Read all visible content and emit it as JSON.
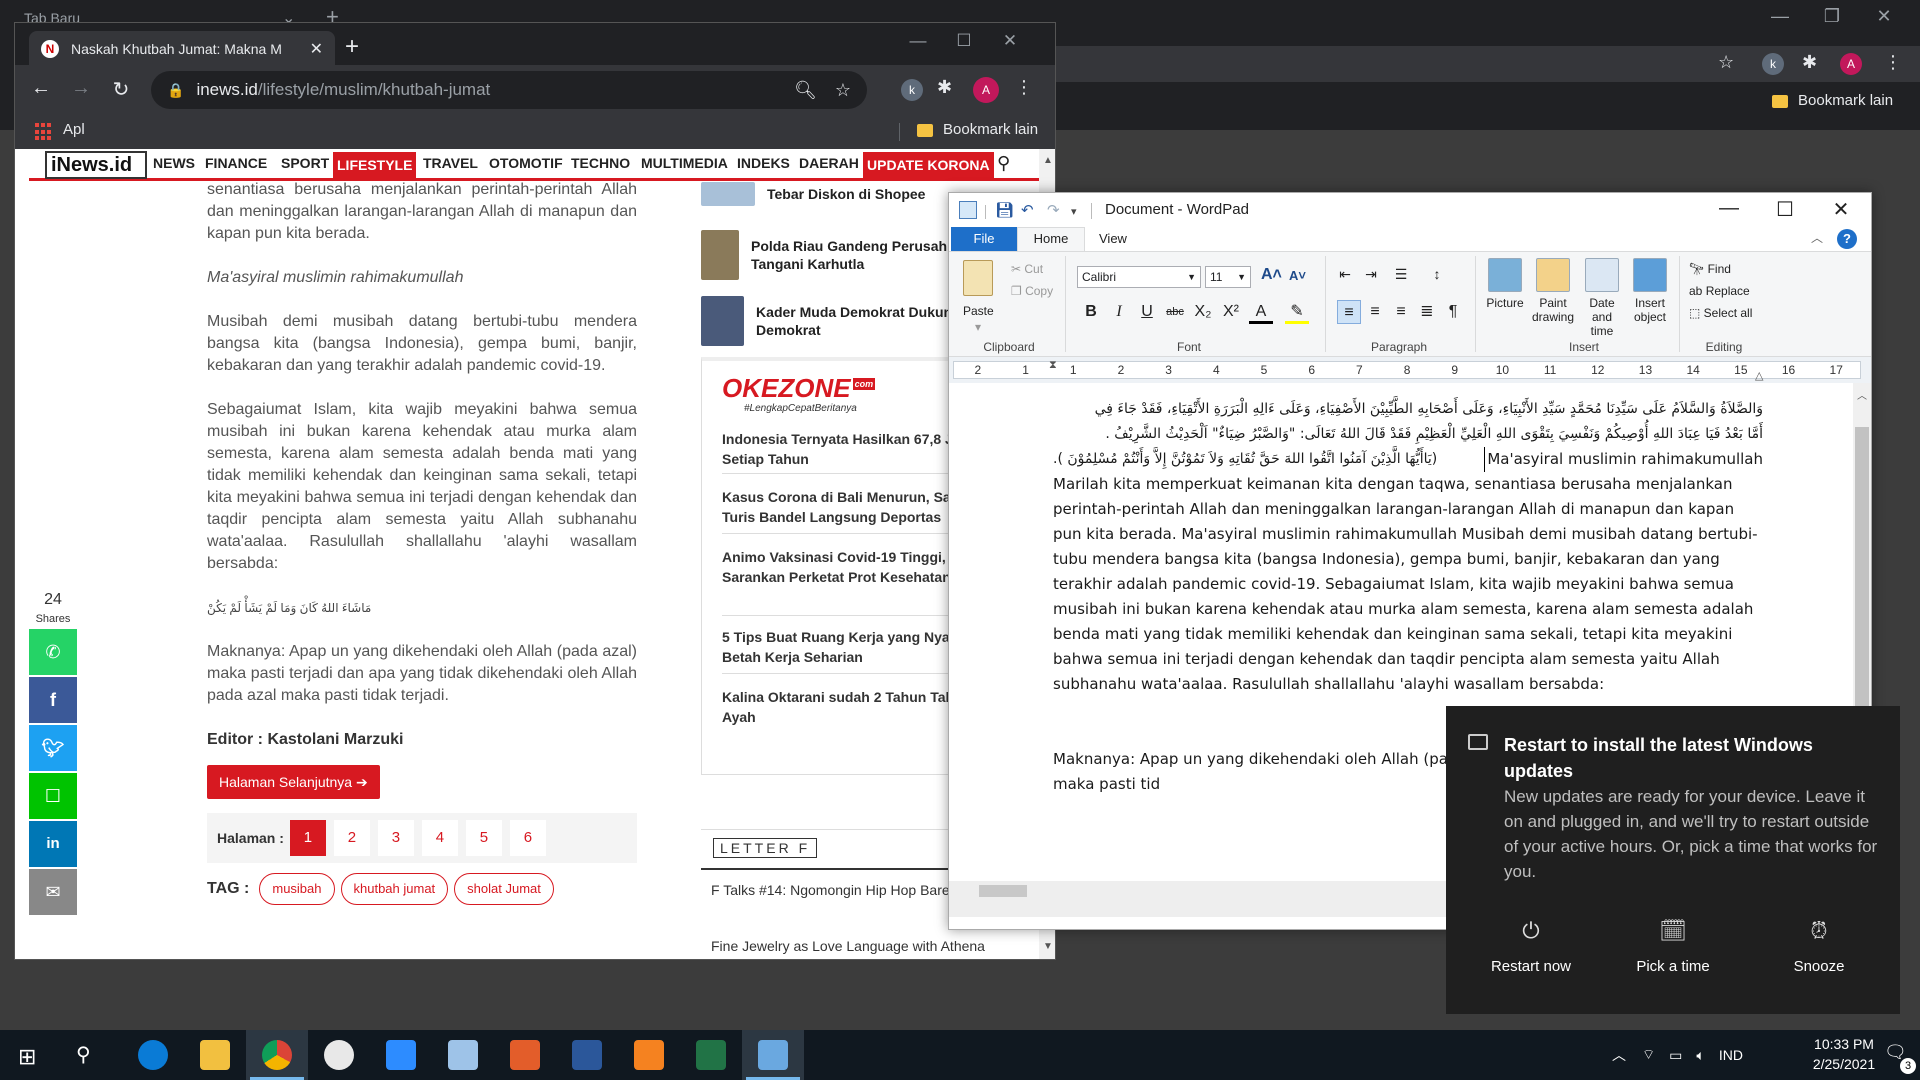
{
  "bg_chrome": {
    "tab_title": "Tab Baru",
    "bookmark_other": "Bookmark lain",
    "profile_initial": "A"
  },
  "chrome": {
    "tab_title": "Naskah Khutbah Jumat: Makna M",
    "url_host": "inews.id",
    "url_path": "/lifestyle/muslim/khutbah-jumat",
    "profile_initial": "A",
    "bookmarks": {
      "apps": "Apl",
      "other": "Bookmark lain"
    }
  },
  "site": {
    "logo": "iNews.id",
    "nav": [
      {
        "label": "NEWS",
        "highlight": false
      },
      {
        "label": "FINANCE",
        "highlight": false
      },
      {
        "label": "SPORT",
        "highlight": false
      },
      {
        "label": "LIFESTYLE",
        "highlight": true
      },
      {
        "label": "TRAVEL",
        "highlight": false
      },
      {
        "label": "OTOMOTIF",
        "highlight": false
      },
      {
        "label": "TECHNO",
        "highlight": false
      },
      {
        "label": "MULTIMEDIA",
        "highlight": false
      },
      {
        "label": "INDEKS",
        "highlight": false
      },
      {
        "label": "DAERAH",
        "highlight": false
      },
      {
        "label": "UPDATE KORONA",
        "highlight": true
      }
    ]
  },
  "article": {
    "p1": "senantiasa berusaha menjalankan perintah-perintah Allah dan meninggalkan larangan-larangan Allah di manapun dan kapan pun kita berada.",
    "p2": "Ma'asyiral muslimin rahimakumullah",
    "p3": "Musibah demi musibah datang bertubi-tubu mendera bangsa kita (bangsa Indonesia), gempa bumi, banjir, kebakaran dan yang terakhir adalah pandemic covid-19.",
    "p4": "Sebagaiumat Islam, kita wajib meyakini bahwa semua musibah ini bukan karena kehendak atau murka alam semesta, karena alam semesta adalah benda mati yang tidak memiliki kehendak dan keinginan sama sekali, tetapi kita meyakini bahwa semua ini terjadi dengan kehendak dan taqdir pencipta alam semesta yaitu Allah subhanahu wata'aalaa. Rasulullah shallallahu 'alayhi wasallam bersabda:",
    "arabic": "مَاشَاءَ اللهُ كَانَ وَمَا لَمْ يَشَأْ لَمْ يَكُنْ",
    "p5": "Maknanya: Apap un yang dikehendaki oleh Allah (pada azal) maka pasti terjadi dan apa yang tidak dikehendaki oleh Allah pada azal maka pasti tidak terjadi.",
    "editor": "Editor : Kastolani Marzuki",
    "next_button": "Halaman Selanjutnya ➔",
    "pager_label": "Halaman :",
    "pages": [
      "1",
      "2",
      "3",
      "4",
      "5",
      "6"
    ],
    "tag_label": "TAG :",
    "tags": [
      "musibah",
      "khutbah jumat",
      "sholat Jumat"
    ]
  },
  "share": {
    "count": "24",
    "label": "Shares"
  },
  "promo": [
    {
      "title": "Tebar Diskon di Shopee"
    },
    {
      "title": "Polda Riau Gandeng Perusah untuk Tangani Karhutla"
    },
    {
      "title": "Kader Muda Demokrat Dukun Partai Demokrat"
    }
  ],
  "okezone": {
    "logo": "OKEZONE",
    "logo_badge": "com",
    "tagline": "#LengkapCepatBeritanya",
    "items": [
      "Indonesia Ternyata Hasilkan 67,8 Jut Sampah Setiap Tahun",
      "Kasus Corona di Bali Menurun, Sandi Uno: Turis Bandel Langsung Deportas",
      "Animo Vaksinasi Covid-19 Tinggi, Epidemiolog Sarankan Perketat Prot Kesehatan",
      "5 Tips Buat Ruang Kerja yang Nyama Bikin Betah Kerja Seharian",
      "Kalina Oktarani sudah 2 Tahun Tak A dengan Ayah"
    ]
  },
  "letter": {
    "logo": "LETTER F",
    "items": [
      "F Talks #14: Ngomongin Hip Hop Bareng Mos",
      "Fine Jewelry as Love Language with Athena"
    ]
  },
  "wordpad": {
    "title": "Document - WordPad",
    "tabs": {
      "file": "File",
      "home": "Home",
      "view": "View"
    },
    "clipboard": {
      "paste": "Paste",
      "cut": "Cut",
      "copy": "Copy",
      "label": "Clipboard"
    },
    "font": {
      "name": "Calibri",
      "size": "11",
      "label": "Font"
    },
    "paragraph_label": "Paragraph",
    "insert": {
      "picture": "Picture",
      "paint": "Paint drawing",
      "datetime": "Date and time",
      "object": "Insert object",
      "label": "Insert"
    },
    "editing": {
      "find": "Find",
      "replace": "Replace",
      "select_all": "Select all",
      "label": "Editing"
    },
    "ruler_marks": [
      "2",
      "1",
      "1",
      "2",
      "3",
      "4",
      "5",
      "6",
      "7",
      "8",
      "9",
      "10",
      "11",
      "12",
      "13",
      "14",
      "15",
      "16",
      "17"
    ],
    "doc_arabic_1": "وَالصَّلاَةُ وَالسَّلاَمُ عَلَى سَيِّدِنَا مُحَمَّدٍ سَيِّدِ الأَنْبِيَاءِ، وَعَلَى أَصْحَابِهِ الطَّيِّبِيْنَ الأَصْفِيَاءِ، وَعَلَى ءَالِهِ الْبَرَرَةِ الأَتْقِيَاءِ، فَقَدْ جَاءَ فِي",
    "doc_arabic_2": "أَمَّا بَعْدُ فَيَا عِبَادَ اللهِ أُوْصِيكُمْ وَنَفْسِيَ بِتَقْوَى اللهِ الْعَلِيِّ الْعَظِيْمِ فَقَدْ قَالَ اللهُ تَعَالَى: \"وَالصَّبْرُ ضِيَاءٌ\" اَلْحَدِيْثُ الشَّرِيْفُ .",
    "doc_arabic_3": "(يَاأَيُّهَا الَّذِيْنَ آمَنُوا اتَّقُوا اللهَ حَقَّ تُقَاتِهِ وَلاَ تَمُوْتُنَّ إِلاَّ وَأَنْتُمْ مُسْلِمُوْنَ ).",
    "doc_inline": "Ma'asyiral muslimin rahimakumullah",
    "doc_body": "Marilah kita memperkuat keimanan kita dengan taqwa, senantiasa berusaha menjalankan perintah-perintah Allah dan meninggalkan larangan-larangan Allah di manapun dan kapan pun kita berada. Ma'asyiral muslimin rahimakumullah Musibah demi musibah datang bertubi-tubu mendera bangsa kita (bangsa Indonesia), gempa bumi, banjir, kebakaran dan yang terakhir adalah pandemic covid-19. Sebagaiumat Islam, kita wajib meyakini bahwa semua musibah ini bukan karena kehendak atau murka alam semesta, karena alam semesta adalah benda mati yang tidak memiliki kehendak dan keinginan sama sekali, tetapi kita meyakini bahwa semua ini terjadi dengan kehendak dan taqdir pencipta alam semesta yaitu Allah subhanahu wata'aalaa. Rasulullah shallallahu 'alayhi wasallam bersabda:",
    "doc_after": "Maknanya: Apap un yang dikehendaki oleh Allah (pa tidak dikehendaki oleh Allah pada azal maka pasti tid"
  },
  "toast": {
    "title": "Restart to install the latest Windows updates",
    "body": "New updates are ready for your device. Leave it on and plugged in, and we'll try to restart outside of your active hours. Or, pick a time that works for you.",
    "actions": {
      "restart": "Restart now",
      "pick": "Pick a time",
      "snooze": "Snooze"
    }
  },
  "taskbar": {
    "language": "IND",
    "time": "10:33 PM",
    "date": "2/25/2021",
    "notifications": "3"
  },
  "colors": {
    "inews_red": "#d71921",
    "chrome_dark": "#202124",
    "wordpad_blue": "#1e6fc9",
    "toast_bg": "#1f1f1f",
    "taskbar_bg": "#101820"
  }
}
